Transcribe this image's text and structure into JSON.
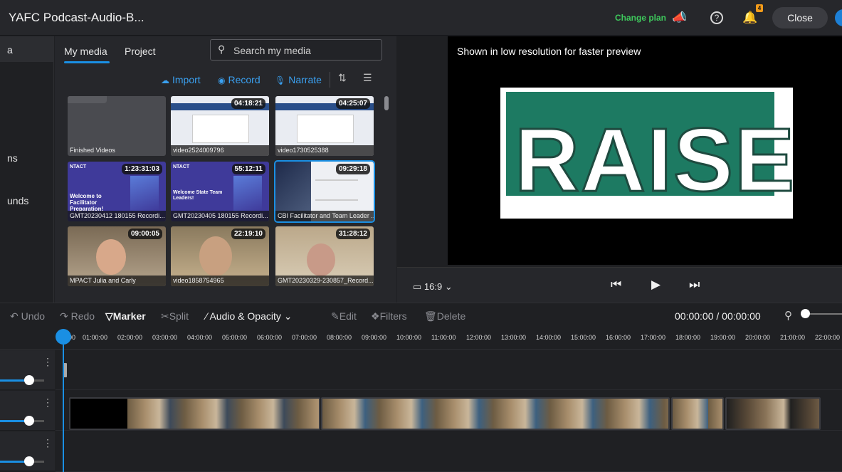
{
  "header": {
    "title": "YAFC Podcast-Audio-B...",
    "change_plan": "Change plan",
    "notification_count": "4",
    "close_label": "Close"
  },
  "rail": {
    "items": [
      "a",
      "ns",
      "unds"
    ]
  },
  "media": {
    "tabs": [
      "My media",
      "Project"
    ],
    "search_placeholder": "Search my media",
    "actions": {
      "import": "Import",
      "record": "Record",
      "narrate": "Narrate"
    },
    "items": [
      {
        "name": "Finished Videos",
        "duration": ""
      },
      {
        "name": "video2524009796",
        "duration": "04:18:21"
      },
      {
        "name": "video1730525388",
        "duration": "04:25:07"
      },
      {
        "name": "GMT20230412 180155 Recordi...",
        "duration": "1:23:31:03"
      },
      {
        "name": "GMT20230405 180155 Recordi...",
        "duration": "55:12:11"
      },
      {
        "name": "CBI Facilitator and Team Leader ...",
        "duration": "09:29:18"
      },
      {
        "name": "MPACT Julia and Carly",
        "duration": "09:00:05"
      },
      {
        "name": "video1858754965",
        "duration": "22:19:10"
      },
      {
        "name": "GMT20230329-230857_Record...",
        "duration": "31:28:12"
      }
    ],
    "thumb_text": {
      "t4_line1": "NTACT",
      "t4_line2": "Welcome to Facilitator Preparation!",
      "t5_line1": "NTACT",
      "t5_line2": "Welcome State Team Leaders!"
    }
  },
  "preview": {
    "note": "Shown in low resolution for faster preview",
    "slide_text": "RAISE",
    "aspect": "16:9"
  },
  "toolbar": {
    "undo": "Undo",
    "redo": "Redo",
    "marker": "Marker",
    "split": "Split",
    "audio_opacity": "Audio & Opacity",
    "edit": "Edit",
    "filters": "Filters",
    "delete": "Delete",
    "time": "00:00:00 / 00:00:00"
  },
  "ruler": [
    "00",
    "01:00:00",
    "02:00:00",
    "03:00:00",
    "04:00:00",
    "05:00:00",
    "06:00:00",
    "07:00:00",
    "08:00:00",
    "09:00:00",
    "10:00:00",
    "11:00:00",
    "12:00:00",
    "13:00:00",
    "14:00:00",
    "15:00:00",
    "16:00:00",
    "17:00:00",
    "18:00:00",
    "19:00:00",
    "20:00:00",
    "21:00:00",
    "22:00:00"
  ],
  "colors": {
    "accent": "#1a8fe3",
    "change_plan": "#3ec95c",
    "badge": "#f39b1a"
  }
}
